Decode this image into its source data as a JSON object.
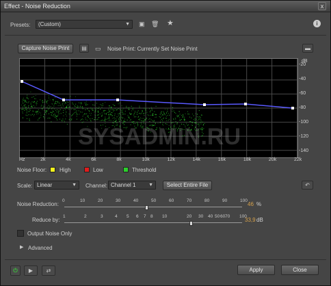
{
  "window": {
    "title": "Effect - Noise Reduction",
    "close_label": "x"
  },
  "presets": {
    "label": "Presets:",
    "value": "(Custom)"
  },
  "noise_print": {
    "capture_label": "Capture Noise Print",
    "status": "Noise Print: Currently Set Noise Print"
  },
  "graph": {
    "db_unit": "dB",
    "y_ticks": [
      "-20",
      "-40",
      "-60",
      "-80",
      "-100",
      "-120",
      "-140"
    ],
    "x_ticks": [
      "Hz",
      "2k",
      "4k",
      "6k",
      "8k",
      "10k",
      "12k",
      "14k",
      "16k",
      "18k",
      "20k",
      "22k"
    ],
    "watermark": "SYSADMIN.RU",
    "curve_color": "#5a5aff",
    "noise_color": "#2fd12f"
  },
  "legend": {
    "title": "Noise Floor:",
    "items": [
      {
        "label": "High",
        "color": "#f2f21d"
      },
      {
        "label": "Low",
        "color": "#e01c1c"
      },
      {
        "label": "Threshold",
        "color": "#2ccf2c"
      }
    ]
  },
  "scale": {
    "label": "Scale:",
    "value": "Linear"
  },
  "channel": {
    "label": "Channel:",
    "value": "Channel 1"
  },
  "select_entire_label": "Select Entire File",
  "noise_reduction": {
    "label": "Noise Reduction:",
    "ticks": [
      "0",
      "10",
      "20",
      "30",
      "40",
      "50",
      "60",
      "70",
      "80",
      "90",
      "100"
    ],
    "value": "46",
    "unit": "%",
    "level_percent": 46
  },
  "reduce_by": {
    "label": "Reduce by:",
    "ticks": [
      "1",
      "2",
      "3",
      "4",
      "5",
      "6",
      "7",
      "8",
      "10",
      "20",
      "30",
      "40",
      "50",
      "60",
      "70",
      "100"
    ],
    "value": "33,9",
    "unit": "dB"
  },
  "output_noise_only": {
    "label": "Output Noise Only",
    "checked": false
  },
  "advanced": {
    "label": "Advanced"
  },
  "footer": {
    "apply_label": "Apply",
    "close_label": "Close"
  }
}
